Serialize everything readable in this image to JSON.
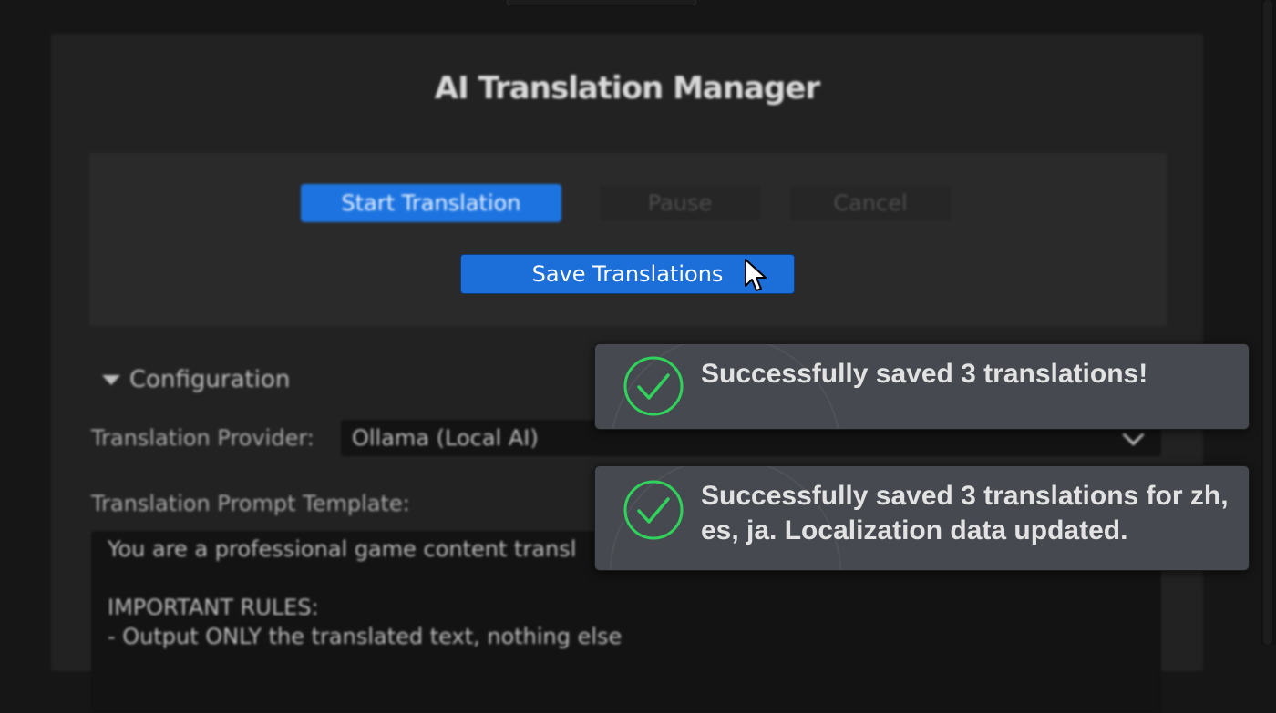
{
  "window": {
    "title": "AI Translation Manager"
  },
  "actions": {
    "start_label": "Start Translation",
    "pause_label": "Pause",
    "cancel_label": "Cancel",
    "save_label": "Save Translations"
  },
  "configuration": {
    "section_label": "Configuration",
    "provider_label": "Translation Provider:",
    "provider_value": "Ollama (Local AI)",
    "prompt_label": "Translation Prompt Template:",
    "prompt_lines": [
      "You are a professional game content transl",
      "",
      "IMPORTANT RULES:",
      "- Output ONLY the translated text, nothing else"
    ]
  },
  "notifications": [
    {
      "icon": "check-circle-icon",
      "message": "Successfully saved 3 translations!"
    },
    {
      "icon": "check-circle-icon",
      "message": "Successfully saved 3 translations for zh, es, ja. Localization data updated."
    }
  ],
  "colors": {
    "accent_blue": "#1c6fd8",
    "success_green": "#2fd35a",
    "toast_bg": "#464a50"
  }
}
